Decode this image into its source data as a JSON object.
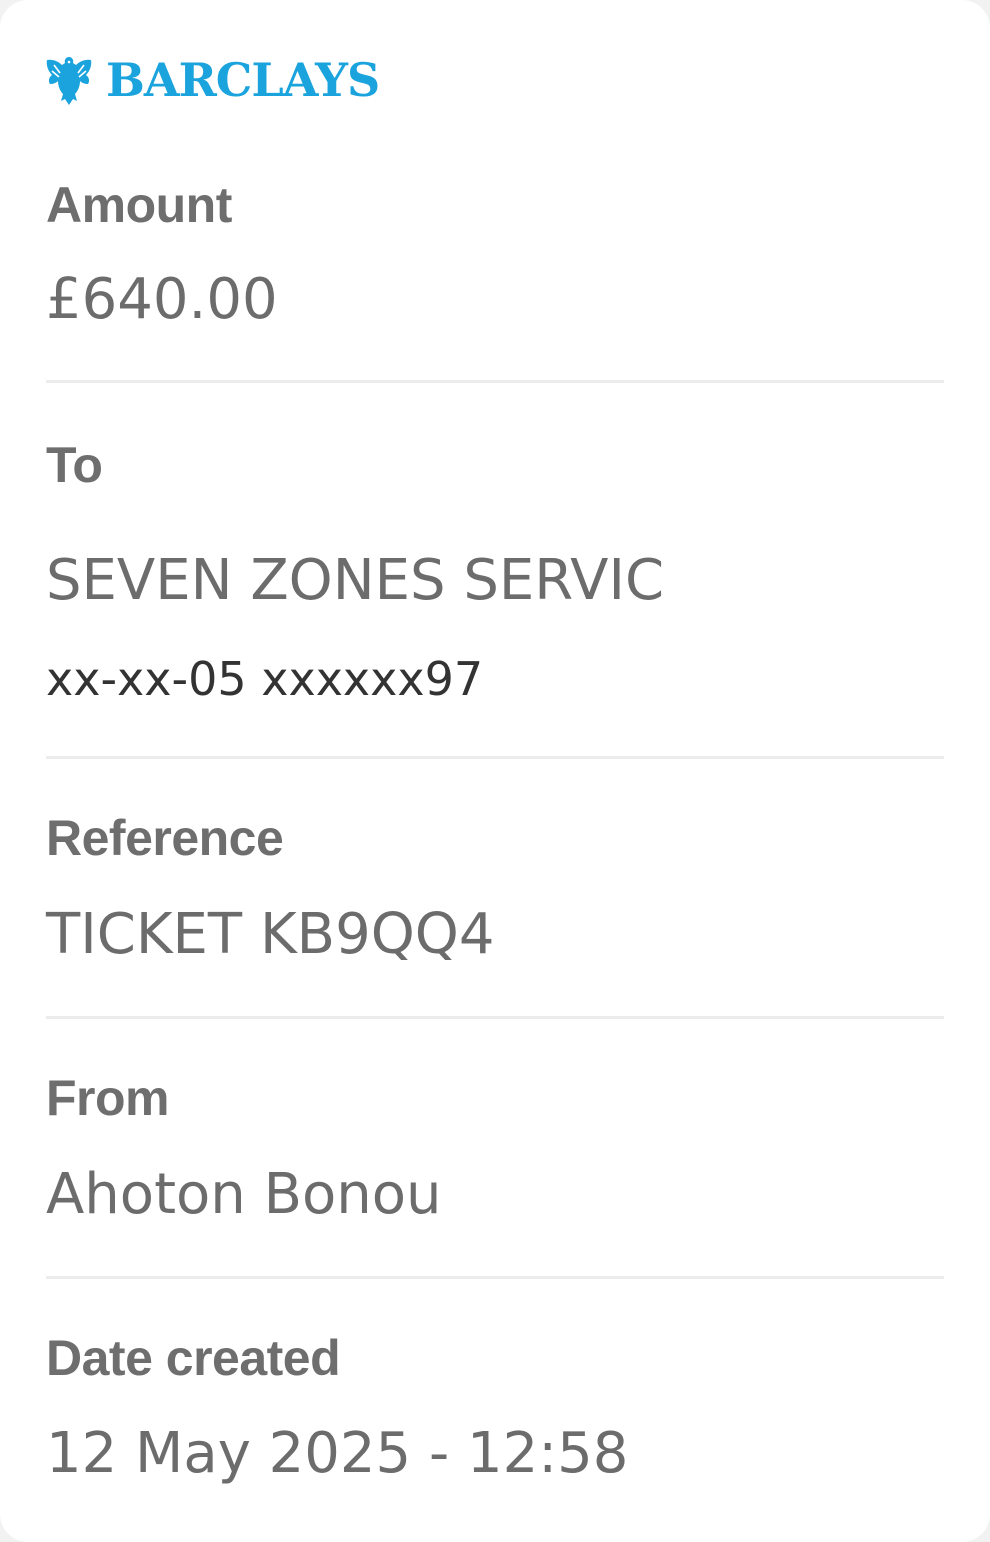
{
  "brand": {
    "name": "BARCLAYS",
    "icon": "eagle-icon",
    "color": "#1aa3dc"
  },
  "details": {
    "amount": {
      "label": "Amount",
      "value": "£640.00"
    },
    "to": {
      "label": "To",
      "name": "SEVEN ZONES SERVIC",
      "account": "xx-xx-05 xxxxxx97"
    },
    "reference": {
      "label": "Reference",
      "value": "TICKET KB9QQ4"
    },
    "from": {
      "label": "From",
      "value": "Ahoton Bonou"
    },
    "date_created": {
      "label": "Date created",
      "value": "12 May 2025 - 12:58"
    }
  }
}
